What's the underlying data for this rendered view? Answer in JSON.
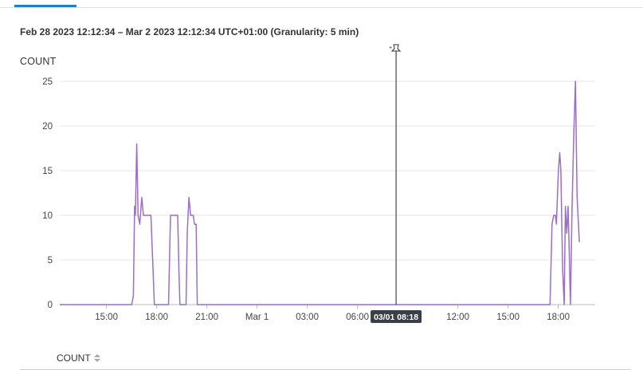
{
  "header": {
    "time_range": "Feb 28 2023 12:12:34 – Mar 2 2023 12:12:34 UTC+01:00 (Granularity: 5 min)"
  },
  "chart_data": {
    "type": "line",
    "ylabel": "COUNT",
    "ylim": [
      0,
      25
    ],
    "y_ticks": [
      "0",
      "5",
      "10",
      "15",
      "20",
      "25"
    ],
    "x_ticks": [
      {
        "label": "15:00",
        "h": 2.79
      },
      {
        "label": "18:00",
        "h": 5.79
      },
      {
        "label": "21:00",
        "h": 8.79
      },
      {
        "label": "Mar 1",
        "h": 11.79
      },
      {
        "label": "03:00",
        "h": 14.79
      },
      {
        "label": "06:00",
        "h": 17.79
      },
      {
        "label": "12:00",
        "h": 23.79
      },
      {
        "label": "15:00",
        "h": 26.79
      },
      {
        "label": "18:00",
        "h": 29.79
      }
    ],
    "x_range_hours": [
      0,
      31
    ],
    "x_unit": "hours since Feb 28 12:12:34",
    "grid": true,
    "line_color": "#9a6fc6",
    "cursor": {
      "h": 20.1,
      "label": "03/01 08:18"
    },
    "series": [
      {
        "points": [
          [
            0,
            0
          ],
          [
            4.3,
            0
          ],
          [
            4.4,
            1
          ],
          [
            4.47,
            11
          ],
          [
            4.52,
            10
          ],
          [
            4.6,
            18
          ],
          [
            4.68,
            10
          ],
          [
            4.78,
            9
          ],
          [
            4.9,
            12
          ],
          [
            5.0,
            10
          ],
          [
            5.45,
            10
          ],
          [
            5.55,
            5
          ],
          [
            5.65,
            0
          ],
          [
            6.5,
            0
          ],
          [
            6.62,
            10
          ],
          [
            7.05,
            10
          ],
          [
            7.12,
            4
          ],
          [
            7.18,
            0
          ],
          [
            7.55,
            0
          ],
          [
            7.62,
            8
          ],
          [
            7.72,
            12
          ],
          [
            7.82,
            10
          ],
          [
            7.98,
            10
          ],
          [
            8.05,
            9
          ],
          [
            8.15,
            9
          ],
          [
            8.22,
            0
          ],
          [
            29.3,
            0
          ],
          [
            29.42,
            9
          ],
          [
            29.52,
            10
          ],
          [
            29.62,
            10
          ],
          [
            29.68,
            9
          ],
          [
            29.8,
            15
          ],
          [
            29.88,
            17
          ],
          [
            29.95,
            15
          ],
          [
            30.05,
            4
          ],
          [
            30.15,
            0
          ],
          [
            30.22,
            11
          ],
          [
            30.3,
            8
          ],
          [
            30.38,
            11
          ],
          [
            30.45,
            6
          ],
          [
            30.52,
            0
          ],
          [
            30.62,
            11
          ],
          [
            30.72,
            19
          ],
          [
            30.82,
            25
          ],
          [
            30.92,
            12
          ],
          [
            31.05,
            7
          ]
        ]
      }
    ]
  },
  "table": {
    "column": "COUNT"
  }
}
